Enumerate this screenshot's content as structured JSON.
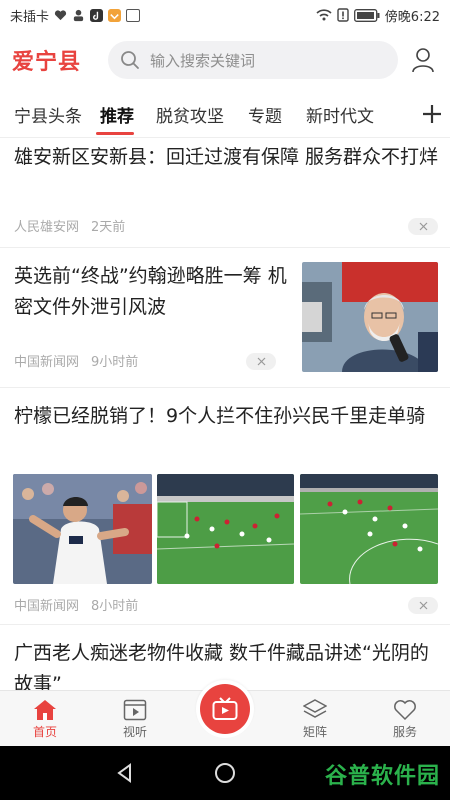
{
  "status_bar": {
    "carrier": "未插卡",
    "time": "傍晚6:22"
  },
  "header": {
    "logo": "爱宁县",
    "search_placeholder": "输入搜索关键词"
  },
  "tabs": [
    {
      "label": "宁县头条",
      "active": false
    },
    {
      "label": "推荐",
      "active": true
    },
    {
      "label": "脱贫攻坚",
      "active": false
    },
    {
      "label": "专题",
      "active": false
    },
    {
      "label": "新时代文",
      "active": false
    }
  ],
  "articles": [
    {
      "title": "雄安新区安新县：回迁过渡有保障 服务群众不打烊",
      "source": "人民雄安网",
      "time": "2天前"
    },
    {
      "title": "英选前“终战”约翰逊略胜一筹 机密文件外泄引风波",
      "source": "中国新闻网",
      "time": "9小时前"
    },
    {
      "title": "柠檬已经脱销了！9个人拦不住孙兴民千里走单骑",
      "source": "中国新闻网",
      "time": "8小时前"
    },
    {
      "title": "广西老人痴迷老物件收藏 数千件藏品讲述“光阴的故事”"
    }
  ],
  "bottom_nav": [
    {
      "label": "首页",
      "icon": "home-icon",
      "active": true
    },
    {
      "label": "视听",
      "icon": "video-icon",
      "active": false
    },
    {
      "label": "矩阵",
      "icon": "matrix-icon",
      "active": false
    },
    {
      "label": "服务",
      "icon": "heart-icon",
      "active": false
    }
  ],
  "watermark": "谷普软件园",
  "colors": {
    "accent": "#e8433f",
    "tab_underline": "#e8433f",
    "watermark": "#2bb24c"
  }
}
